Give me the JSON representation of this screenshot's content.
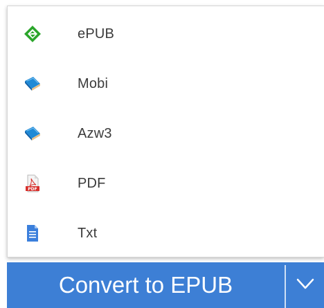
{
  "menu": {
    "items": [
      {
        "label": "ePUB",
        "icon": "epub-icon"
      },
      {
        "label": "Mobi",
        "icon": "mobi-book-icon"
      },
      {
        "label": "Azw3",
        "icon": "azw3-book-icon"
      },
      {
        "label": "PDF",
        "icon": "pdf-file-icon"
      },
      {
        "label": "Txt",
        "icon": "txt-file-icon"
      }
    ]
  },
  "convert": {
    "button_label": "Convert to EPUB",
    "dropdown_icon": "chevron-down-icon"
  },
  "colors": {
    "accent": "#3d7fd5",
    "epub_green": "#2aa52a",
    "book_blue": "#1f8ad6",
    "pdf_red": "#d7302c",
    "txt_blue": "#3b7fdc"
  }
}
